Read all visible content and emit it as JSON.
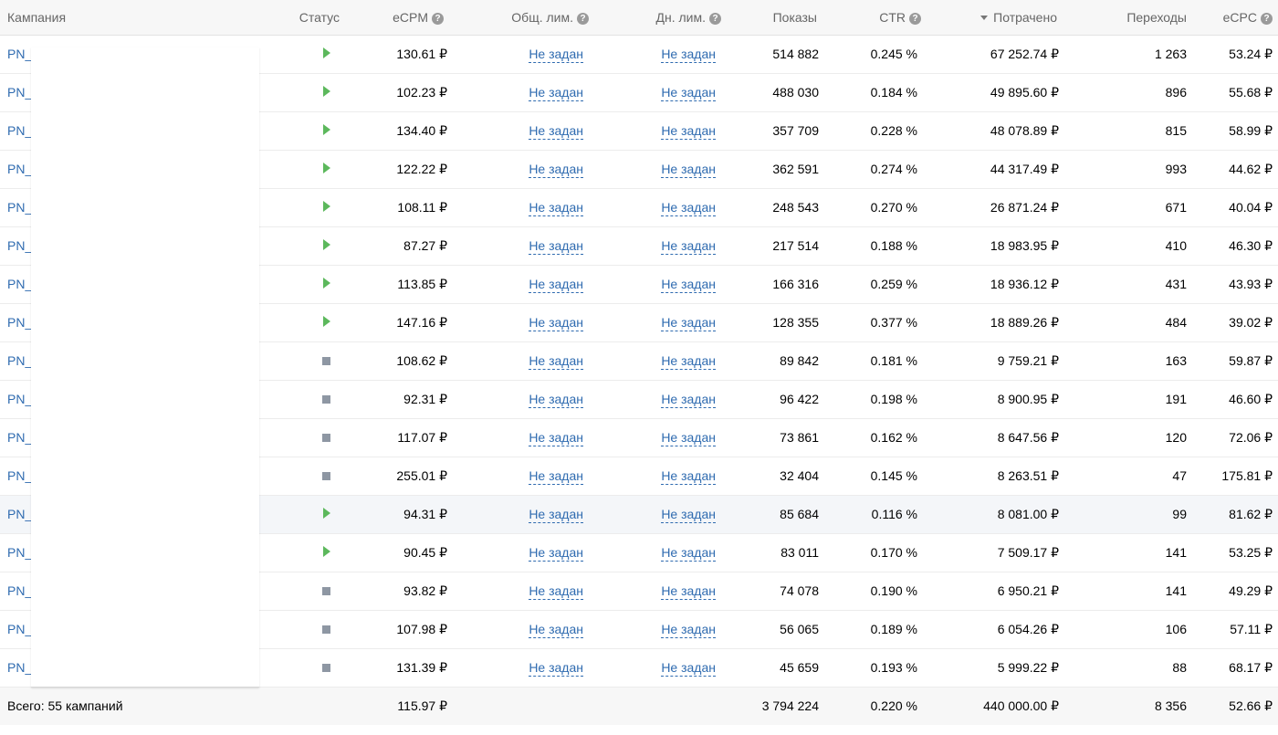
{
  "columns": [
    {
      "label": "Кампания"
    },
    {
      "label": "Статус"
    },
    {
      "label": "eCPM"
    },
    {
      "label": "Общ. лим."
    },
    {
      "label": "Дн. лим."
    },
    {
      "label": "Показы"
    },
    {
      "label": "CTR"
    },
    {
      "label": "Потрачено"
    },
    {
      "label": "Переходы"
    },
    {
      "label": "eCPC"
    }
  ],
  "rows": [
    {
      "campaign": "PN_",
      "status": "running",
      "ecpm": "130.61 ₽",
      "total_limit": "Не задан",
      "daily_limit": "Не задан",
      "impressions": "514 882",
      "ctr": "0.245 %",
      "spent": "67 252.74 ₽",
      "clicks": "1 263",
      "ecpc": "53.24 ₽"
    },
    {
      "campaign": "PN_",
      "status": "running",
      "ecpm": "102.23 ₽",
      "total_limit": "Не задан",
      "daily_limit": "Не задан",
      "impressions": "488 030",
      "ctr": "0.184 %",
      "spent": "49 895.60 ₽",
      "clicks": "896",
      "ecpc": "55.68 ₽"
    },
    {
      "campaign": "PN_",
      "status": "running",
      "ecpm": "134.40 ₽",
      "total_limit": "Не задан",
      "daily_limit": "Не задан",
      "impressions": "357 709",
      "ctr": "0.228 %",
      "spent": "48 078.89 ₽",
      "clicks": "815",
      "ecpc": "58.99 ₽"
    },
    {
      "campaign": "PN_",
      "status": "running",
      "ecpm": "122.22 ₽",
      "total_limit": "Не задан",
      "daily_limit": "Не задан",
      "impressions": "362 591",
      "ctr": "0.274 %",
      "spent": "44 317.49 ₽",
      "clicks": "993",
      "ecpc": "44.62 ₽"
    },
    {
      "campaign": "PN_",
      "status": "running",
      "ecpm": "108.11 ₽",
      "total_limit": "Не задан",
      "daily_limit": "Не задан",
      "impressions": "248 543",
      "ctr": "0.270 %",
      "spent": "26 871.24 ₽",
      "clicks": "671",
      "ecpc": "40.04 ₽"
    },
    {
      "campaign": "PN_",
      "status": "running",
      "ecpm": "87.27 ₽",
      "total_limit": "Не задан",
      "daily_limit": "Не задан",
      "impressions": "217 514",
      "ctr": "0.188 %",
      "spent": "18 983.95 ₽",
      "clicks": "410",
      "ecpc": "46.30 ₽"
    },
    {
      "campaign": "PN_",
      "status": "running",
      "ecpm": "113.85 ₽",
      "total_limit": "Не задан",
      "daily_limit": "Не задан",
      "impressions": "166 316",
      "ctr": "0.259 %",
      "spent": "18 936.12 ₽",
      "clicks": "431",
      "ecpc": "43.93 ₽"
    },
    {
      "campaign": "PN_",
      "status": "running",
      "ecpm": "147.16 ₽",
      "total_limit": "Не задан",
      "daily_limit": "Не задан",
      "impressions": "128 355",
      "ctr": "0.377 %",
      "spent": "18 889.26 ₽",
      "clicks": "484",
      "ecpc": "39.02 ₽"
    },
    {
      "campaign": "PN_",
      "status": "stopped",
      "ecpm": "108.62 ₽",
      "total_limit": "Не задан",
      "daily_limit": "Не задан",
      "impressions": "89 842",
      "ctr": "0.181 %",
      "spent": "9 759.21 ₽",
      "clicks": "163",
      "ecpc": "59.87 ₽"
    },
    {
      "campaign": "PN_",
      "status": "stopped",
      "ecpm": "92.31 ₽",
      "total_limit": "Не задан",
      "daily_limit": "Не задан",
      "impressions": "96 422",
      "ctr": "0.198 %",
      "spent": "8 900.95 ₽",
      "clicks": "191",
      "ecpc": "46.60 ₽"
    },
    {
      "campaign": "PN_",
      "status": "stopped",
      "ecpm": "117.07 ₽",
      "total_limit": "Не задан",
      "daily_limit": "Не задан",
      "impressions": "73 861",
      "ctr": "0.162 %",
      "spent": "8 647.56 ₽",
      "clicks": "120",
      "ecpc": "72.06 ₽"
    },
    {
      "campaign": "PN_",
      "status": "stopped",
      "ecpm": "255.01 ₽",
      "total_limit": "Не задан",
      "daily_limit": "Не задан",
      "impressions": "32 404",
      "ctr": "0.145 %",
      "spent": "8 263.51 ₽",
      "clicks": "47",
      "ecpc": "175.81 ₽"
    },
    {
      "campaign": "PN_",
      "status": "running",
      "ecpm": "94.31 ₽",
      "total_limit": "Не задан",
      "daily_limit": "Не задан",
      "impressions": "85 684",
      "ctr": "0.116 %",
      "spent": "8 081.00 ₽",
      "clicks": "99",
      "ecpc": "81.62 ₽",
      "hover": true
    },
    {
      "campaign": "PN_",
      "status": "running",
      "ecpm": "90.45 ₽",
      "total_limit": "Не задан",
      "daily_limit": "Не задан",
      "impressions": "83 011",
      "ctr": "0.170 %",
      "spent": "7 509.17 ₽",
      "clicks": "141",
      "ecpc": "53.25 ₽"
    },
    {
      "campaign": "PN_",
      "status": "stopped",
      "ecpm": "93.82 ₽",
      "total_limit": "Не задан",
      "daily_limit": "Не задан",
      "impressions": "74 078",
      "ctr": "0.190 %",
      "spent": "6 950.21 ₽",
      "clicks": "141",
      "ecpc": "49.29 ₽"
    },
    {
      "campaign": "PN_",
      "status": "stopped",
      "ecpm": "107.98 ₽",
      "total_limit": "Не задан",
      "daily_limit": "Не задан",
      "impressions": "56 065",
      "ctr": "0.189 %",
      "spent": "6 054.26 ₽",
      "clicks": "106",
      "ecpc": "57.11 ₽"
    },
    {
      "campaign": "PN_",
      "status": "stopped",
      "ecpm": "131.39 ₽",
      "total_limit": "Не задан",
      "daily_limit": "Не задан",
      "impressions": "45 659",
      "ctr": "0.193 %",
      "spent": "5 999.22 ₽",
      "clicks": "88",
      "ecpc": "68.17 ₽"
    }
  ],
  "footer": {
    "total_label": "Всего: 55 кампаний",
    "ecpm": "115.97 ₽",
    "impressions": "3 794 224",
    "ctr": "0.220 %",
    "spent": "440 000.00 ₽",
    "clicks": "8 356",
    "ecpc": "52.66 ₽"
  },
  "icons": {
    "help": "question-circle-icon",
    "sort": "sort-desc-icon",
    "running": "play-icon",
    "stopped": "stop-icon"
  },
  "colors": {
    "link": "#2f6bb0",
    "running": "#5cb85c",
    "stopped": "#8e97a3"
  }
}
